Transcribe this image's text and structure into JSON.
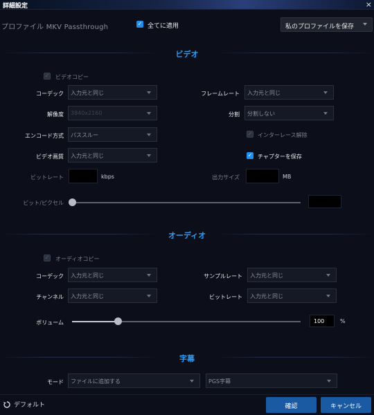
{
  "window": {
    "title": "詳細設定",
    "close_icon": "×"
  },
  "profile": {
    "label": "プロファイル MKV Passthrough",
    "apply_all": {
      "checked": true,
      "label": "全てに適用"
    },
    "save_button": "私のプロファイルを保存"
  },
  "video": {
    "section_title": "ビデオ",
    "copy": {
      "checked": false,
      "label": "ビデオコピー"
    },
    "codec": {
      "label": "コーデック",
      "value": "入力元と同じ"
    },
    "framerate": {
      "label": "フレームレート",
      "value": "入力元と同じ"
    },
    "resolution": {
      "label": "解像度",
      "value": "3840x2160"
    },
    "split": {
      "label": "分割",
      "value": "分割しない"
    },
    "encode_method": {
      "label": "エンコード方式",
      "value": "パススルー"
    },
    "deinterlace": {
      "checked": false,
      "label": "インターレース解除"
    },
    "quality": {
      "label": "ビデオ画質",
      "value": "入力元と同じ"
    },
    "save_chapters": {
      "checked": true,
      "label": "チャプターを保存"
    },
    "bitrate": {
      "label": "ビットレート",
      "value": "",
      "unit": "kbps"
    },
    "output_size": {
      "label": "出力サイズ",
      "value": "",
      "unit": "MB"
    },
    "bits_per_pixel": {
      "label": "ビット/ピクセル",
      "value": "",
      "level": 0
    }
  },
  "audio": {
    "section_title": "オーディオ",
    "copy": {
      "checked": false,
      "label": "オーディオコピー"
    },
    "codec": {
      "label": "コーデック",
      "value": "入力元と同じ"
    },
    "sample_rate": {
      "label": "サンプルレート",
      "value": "入力元と同じ"
    },
    "channels": {
      "label": "チャンネル",
      "value": "入力元と同じ"
    },
    "bitrate": {
      "label": "ビットレート",
      "value": "入力元と同じ"
    },
    "volume": {
      "label": "ボリューム",
      "value": "100",
      "unit": "%",
      "level": 0.2
    }
  },
  "subtitles": {
    "section_title": "字幕",
    "mode": {
      "label": "モード",
      "value": "ファイルに追加する"
    },
    "type": {
      "value": "PGS字幕"
    }
  },
  "footer": {
    "default_label": "デフォルト",
    "confirm_button": "確認",
    "cancel_button": "キャンセル"
  },
  "colors": {
    "accent": "#2f9bf0",
    "button": "#1a5aa3",
    "background": "#0c0f1a"
  }
}
